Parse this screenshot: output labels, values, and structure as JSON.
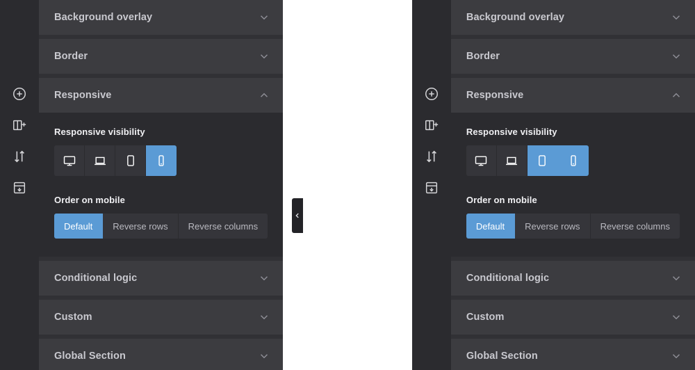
{
  "theme": {
    "accent": "#5b9bd5",
    "panel_header_bg": "#3c3c40",
    "panel_body_bg": "#2b2b2f",
    "rail_bg": "#2b2b2f",
    "gutter_bg": "#19191c",
    "title_color": "#c9c9cf",
    "label_color": "#f0f0f3"
  },
  "rail": {
    "items": [
      {
        "icon": "add-circle-icon",
        "name": "add-element"
      },
      {
        "icon": "add-column-icon",
        "name": "add-column"
      },
      {
        "icon": "move-vertical-icon",
        "name": "reorder"
      },
      {
        "icon": "save-section-icon",
        "name": "save-section"
      }
    ]
  },
  "collapse_tab": {
    "icon": "chevron-left-icon",
    "label": "Collapse panel"
  },
  "sections": {
    "background_overlay": {
      "title": "Background overlay",
      "state": "collapsed",
      "chevron": "chevron-down-icon"
    },
    "border": {
      "title": "Border",
      "state": "collapsed",
      "chevron": "chevron-down-icon"
    },
    "responsive": {
      "title": "Responsive",
      "state": "expanded",
      "chevron": "chevron-up-icon"
    },
    "conditional_logic": {
      "title": "Conditional logic",
      "state": "collapsed",
      "chevron": "chevron-down-icon"
    },
    "custom": {
      "title": "Custom",
      "state": "collapsed",
      "chevron": "chevron-down-icon"
    },
    "global_section": {
      "title": "Global Section",
      "state": "collapsed",
      "chevron": "chevron-down-icon"
    }
  },
  "responsive_visibility": {
    "label": "Responsive visibility",
    "devices": [
      {
        "name": "desktop",
        "icon": "desktop-icon"
      },
      {
        "name": "laptop",
        "icon": "laptop-icon"
      },
      {
        "name": "tablet",
        "icon": "tablet-icon"
      },
      {
        "name": "mobile",
        "icon": "mobile-icon"
      }
    ]
  },
  "order_on_mobile": {
    "label": "Order on mobile",
    "options": [
      {
        "name": "default",
        "label": "Default"
      },
      {
        "name": "reverse-rows",
        "label": "Reverse rows"
      },
      {
        "name": "reverse-columns",
        "label": "Reverse columns"
      }
    ]
  },
  "panels": {
    "left": {
      "id": "before",
      "visibility_active": [
        false,
        false,
        false,
        true
      ],
      "order_active_index": 0
    },
    "right": {
      "id": "after",
      "visibility_active": [
        false,
        false,
        true,
        true
      ],
      "order_active_index": 0
    }
  }
}
